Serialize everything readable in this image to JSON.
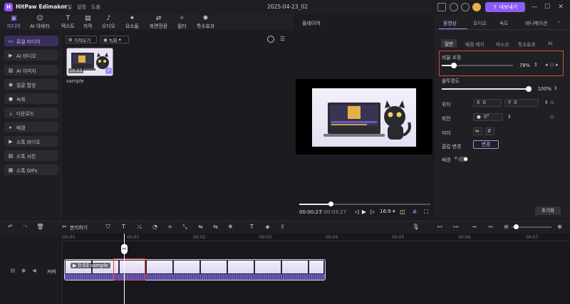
{
  "titlebar": {
    "logo_text": "H",
    "app_title": "HitPaw Edimakor",
    "menu": [
      "파일",
      "설정",
      "도움"
    ],
    "project_date": "2025-04-23_02",
    "export_label": "내보내기",
    "export_icon": "upload-icon"
  },
  "media_toolbar": {
    "items": [
      {
        "label": "미디어",
        "icon": "▣"
      },
      {
        "label": "AI 아바타",
        "icon": "☺"
      },
      {
        "label": "텍스트",
        "icon": "T"
      },
      {
        "label": "자막",
        "icon": "▤"
      },
      {
        "label": "오디오",
        "icon": "♪"
      },
      {
        "label": "요소들",
        "icon": "✦"
      },
      {
        "label": "화면전환",
        "icon": "⇄"
      },
      {
        "label": "필터",
        "icon": "✧"
      },
      {
        "label": "특수효과",
        "icon": "✺"
      }
    ]
  },
  "sidebar": {
    "items": [
      {
        "label": "로컬 미디어",
        "icon": "▭"
      },
      {
        "label": "AI 비디오",
        "icon": "▶"
      },
      {
        "label": "AI 이미지",
        "icon": "▨"
      },
      {
        "label": "얼굴 합성",
        "icon": "◉"
      },
      {
        "label": "녹화",
        "icon": "●"
      },
      {
        "label": "다운로드",
        "icon": "⤓"
      },
      {
        "label": "배경",
        "icon": "▸"
      },
      {
        "label": "스톡 비디오",
        "icon": "▶"
      },
      {
        "label": "스톡 사진",
        "icon": "▨"
      },
      {
        "label": "스톡 GIFs",
        "icon": "▦"
      }
    ]
  },
  "media": {
    "import_label": "가져오기",
    "record_label": "녹화",
    "thumb_duration": "00:03",
    "thumb_name": "sample"
  },
  "player": {
    "title": "플레이어",
    "time_current": "00:00:27",
    "time_total": "/ 00:03:27",
    "progress": 0.24,
    "aspect": "16:9 ▾"
  },
  "right_panel": {
    "tabs": [
      "동영상",
      "오디오",
      "속도",
      "애니메이션"
    ],
    "more": "›",
    "subtabs": [
      "일반",
      "배경 제거",
      "마스크",
      "특수효과",
      "AI"
    ],
    "scale_label": "비율 조정",
    "scale_value": "78%",
    "scale_level": 0.78,
    "opacity_label": "불투명도",
    "opacity_value": "100%",
    "opacity_level": 1.0,
    "position_label": "위치",
    "pos_x_label": "X",
    "pos_x_value": "0",
    "pos_y_label": "Y",
    "pos_y_value": "0",
    "rotate_label": "회전",
    "rotate_value": "0°",
    "mirror_label": "미러",
    "clip_replace_label": "클립 변경",
    "replace_label": "변경",
    "background_label": "배경",
    "reset_label": "초기화"
  },
  "timeline": {
    "split_label": "분리하기",
    "ruler": [
      "00:00",
      "00:01",
      "00:02",
      "00:03",
      "00:04",
      "00:05",
      "00:06",
      "00:07"
    ],
    "clip_label": "0:03 sample",
    "track_label": "커버"
  }
}
